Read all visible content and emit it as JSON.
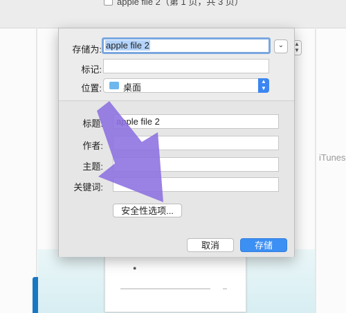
{
  "background": {
    "window_title": "apple file 2（第 1 页，共 3 页）",
    "side_label": "iTunes"
  },
  "dialog": {
    "save_as_label": "存储为:",
    "save_as_value": "apple file 2",
    "tags_label": "标记:",
    "tags_value": "",
    "location_label": "位置:",
    "location_value": "桌面",
    "metadata": {
      "title_label": "标题:",
      "title_value": "apple file 2",
      "author_label": "作者:",
      "author_value": "",
      "subject_label": "主题:",
      "subject_value": "",
      "keywords_label": "关键词:",
      "keywords_value": ""
    },
    "security_button": "安全性选项...",
    "cancel_button": "取消",
    "save_button": "存储"
  },
  "colors": {
    "accent": "#3c8ff3",
    "annotation_arrow": "#8c6fe0"
  },
  "icons": {
    "expand": "chevron-down-icon",
    "location": "folder-icon",
    "stepper": "updown-arrows-icon"
  }
}
